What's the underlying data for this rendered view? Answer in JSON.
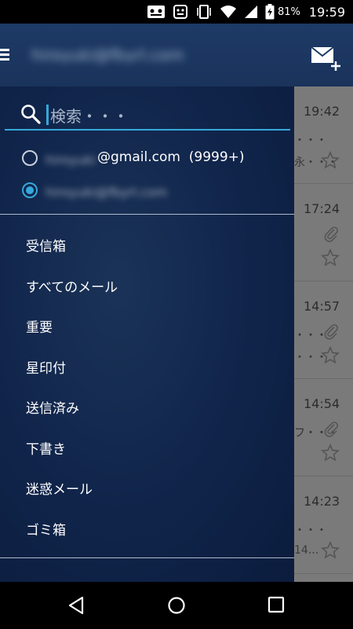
{
  "statusbar": {
    "battery_percent": "81%",
    "time": "19:59"
  },
  "header": {
    "account_title": "hiroyuki@fbyrl.com"
  },
  "drawer": {
    "search_placeholder": "検索・・・",
    "accounts": [
      {
        "blurred_name": "hiroyuki",
        "address_suffix": "@gmail.com",
        "count": "(9999+)",
        "selected": false
      },
      {
        "blurred_name": "hiroyuki@fbyrl.com",
        "address_suffix": "",
        "count": "",
        "selected": true
      }
    ],
    "menu_items": [
      {
        "label": "受信箱"
      },
      {
        "label": "すべてのメール"
      },
      {
        "label": "重要"
      },
      {
        "label": "星印付"
      },
      {
        "label": "送信済み"
      },
      {
        "label": "下書き"
      },
      {
        "label": "迷惑メール"
      },
      {
        "label": "ゴミ箱"
      }
    ]
  },
  "email_list": [
    {
      "time": "19:42",
      "snippet": "・・・",
      "snippet2": "永・・・",
      "attachment": false,
      "starred": false
    },
    {
      "time": "17:24",
      "snippet": "",
      "snippet2": "",
      "attachment": true,
      "starred": false
    },
    {
      "time": "14:57",
      "snippet": "・・・",
      "snippet2": "・・・",
      "attachment": true,
      "starred": false
    },
    {
      "time": "14:54",
      "snippet": "フ・・・",
      "snippet2": "",
      "attachment": true,
      "starred": false
    },
    {
      "time": "14:23",
      "snippet": "・・・",
      "snippet2": "14...",
      "attachment": false,
      "starred": false
    }
  ],
  "colors": {
    "accent": "#35a8da",
    "drawer_bg": "#10244a",
    "header_bg": "#1d3a66"
  }
}
